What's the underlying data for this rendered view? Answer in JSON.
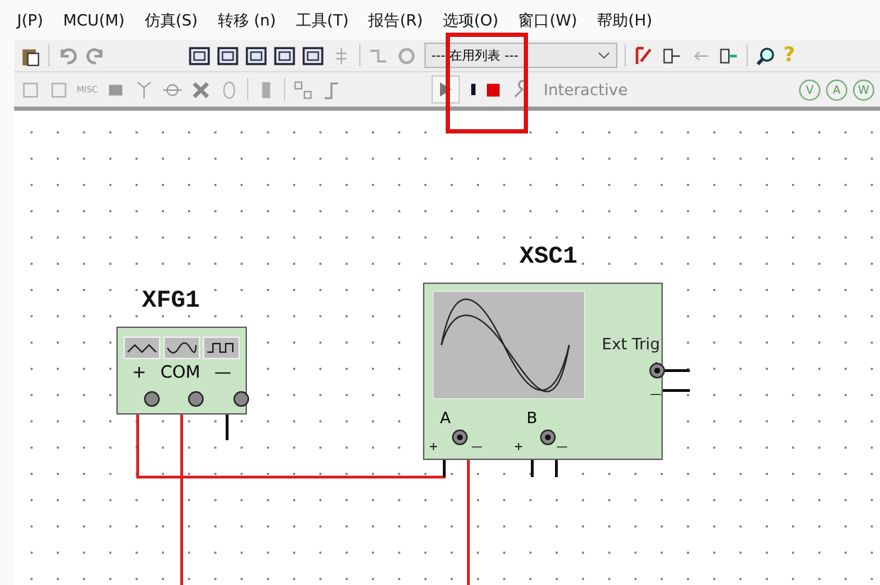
{
  "menu": [
    {
      "label": "J(P)"
    },
    {
      "label": "MCU(M)"
    },
    {
      "label": "仿真(S)"
    },
    {
      "label": "转移 (n)"
    },
    {
      "label": "工具(T)"
    },
    {
      "label": "报告(R)"
    },
    {
      "label": "选项(O)"
    },
    {
      "label": "窗口(W)"
    },
    {
      "label": "帮助(H)"
    }
  ],
  "toolbar": {
    "in_use_list": "--- 在用列表 ---",
    "help_glyph": "?",
    "misc_label": "MISC"
  },
  "simulation": {
    "running": false,
    "mode": "Interactive",
    "probes": [
      "V",
      "A",
      "W"
    ]
  },
  "highlight": {
    "shown": true
  },
  "instruments": [
    {
      "kind": "function_generator",
      "name": "XFG1",
      "terminals": [
        "+",
        "COM",
        "—"
      ]
    },
    {
      "kind": "oscilloscope",
      "name": "XSC1",
      "trigger_label": "Ext Trig",
      "channels": [
        "A",
        "B"
      ],
      "plus": "+",
      "minus": "—"
    }
  ]
}
